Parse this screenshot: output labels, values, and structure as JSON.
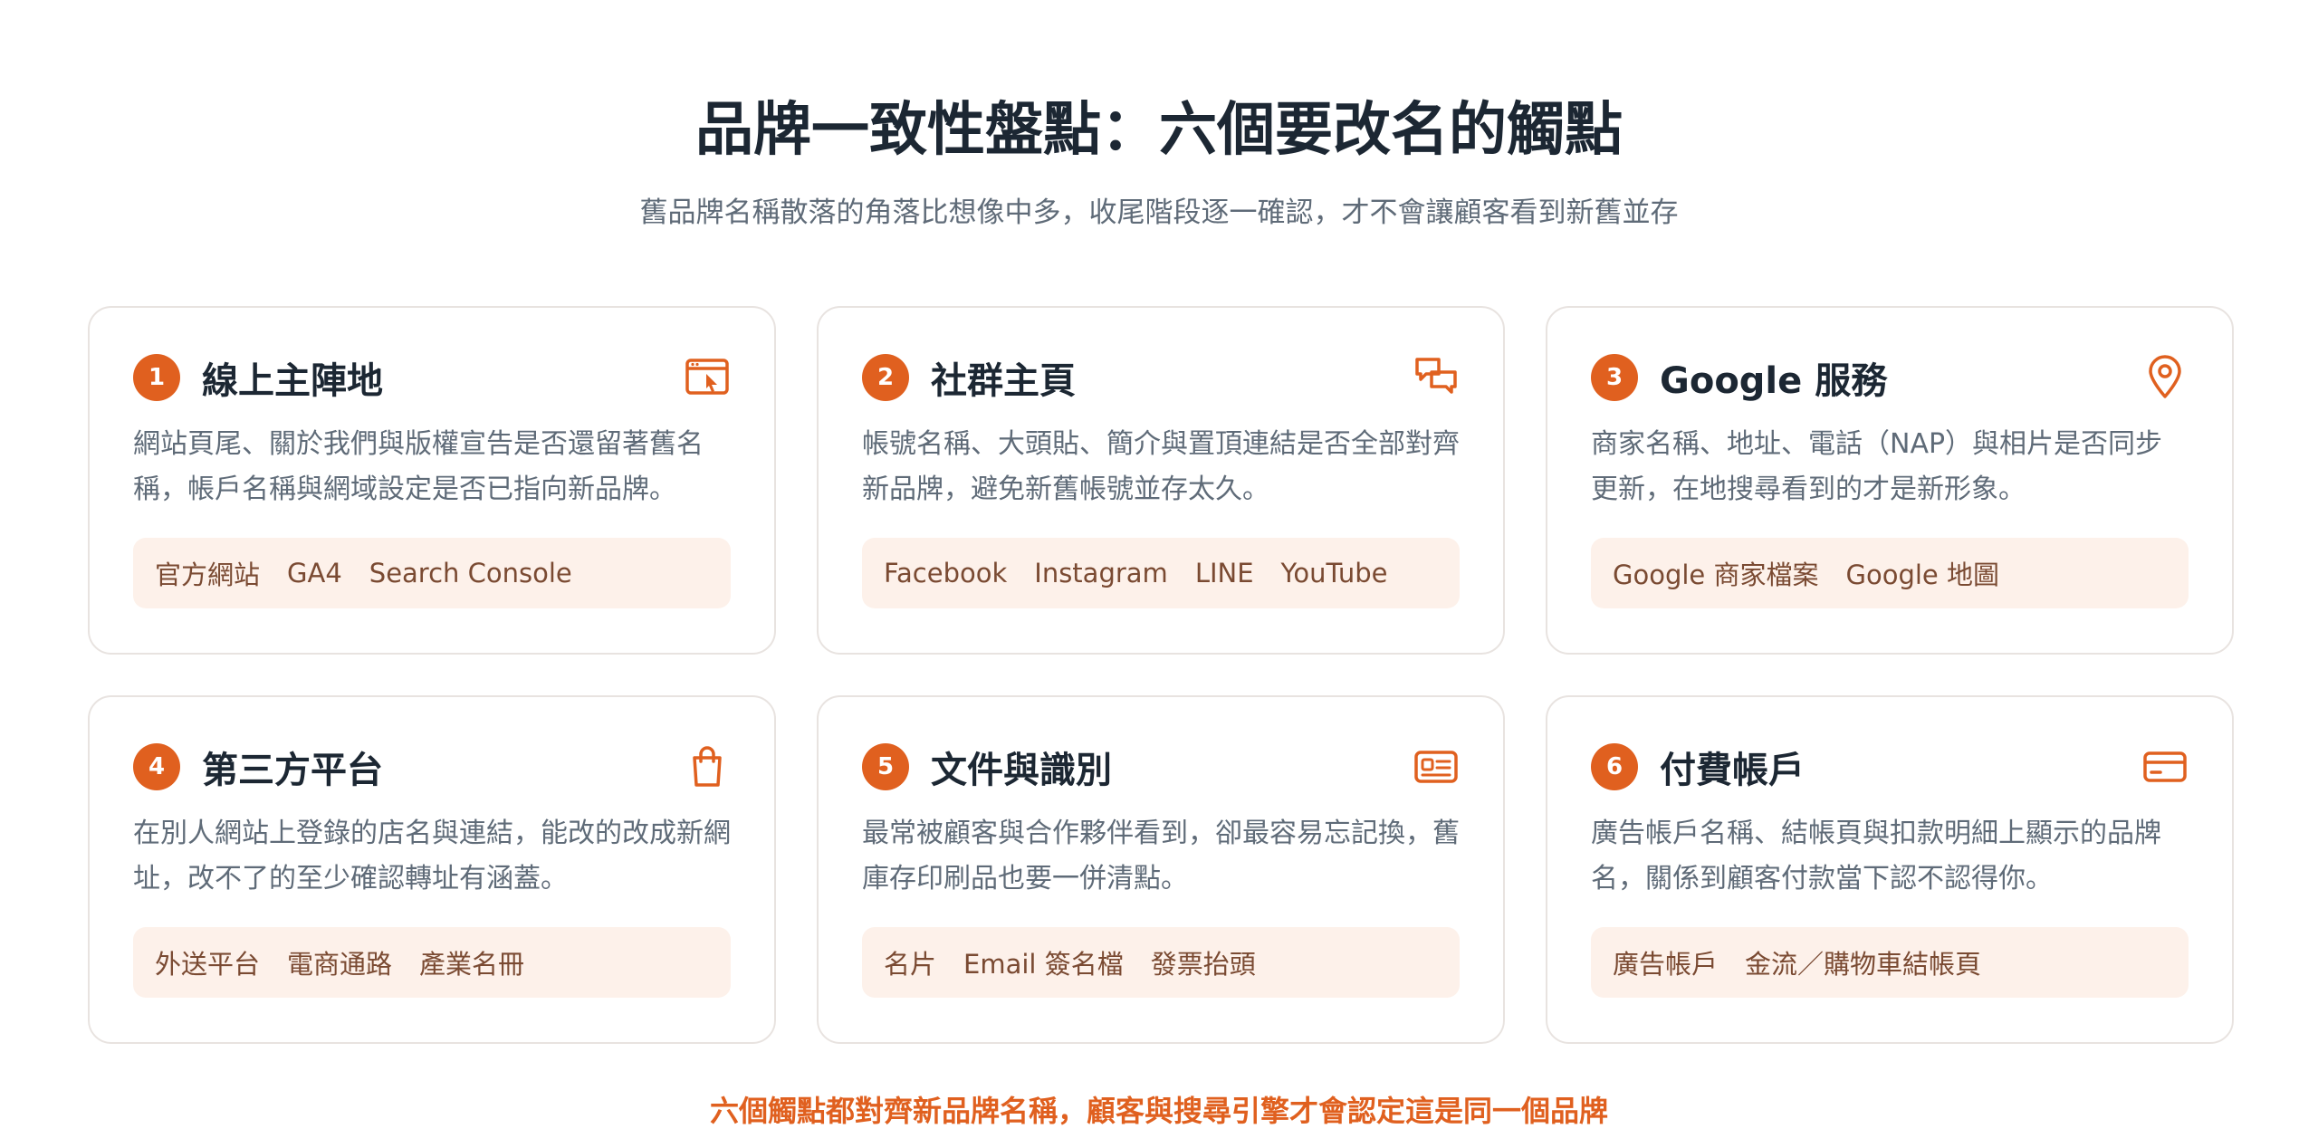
{
  "header": {
    "title": "品牌一致性盤點：六個要改名的觸點",
    "subtitle": "舊品牌名稱散落的角落比想像中多，收尾階段逐一確認，才不會讓顧客看到新舊並存"
  },
  "colors": {
    "accent": "#e0601f",
    "tag_bg": "#fdf1ea",
    "text_dark": "#1c2733",
    "text_muted": "#5f6b78"
  },
  "cards": [
    {
      "number": "1",
      "title": "線上主陣地",
      "icon": "browser-cursor-icon",
      "description": "網站頁尾、關於我們與版權宣告是否還留著舊名稱，帳戶名稱與網域設定是否已指向新品牌。",
      "tags": [
        "官方網站",
        "GA4",
        "Search Console"
      ]
    },
    {
      "number": "2",
      "title": "社群主頁",
      "icon": "chat-bubbles-icon",
      "description": "帳號名稱、大頭貼、簡介與置頂連結是否全部對齊新品牌，避免新舊帳號並存太久。",
      "tags": [
        "Facebook",
        "Instagram",
        "LINE",
        "YouTube"
      ]
    },
    {
      "number": "3",
      "title": "Google 服務",
      "icon": "map-pin-icon",
      "description": "商家名稱、地址、電話（NAP）與相片是否同步更新，在地搜尋看到的才是新形象。",
      "tags": [
        "Google 商家檔案",
        "Google 地圖"
      ]
    },
    {
      "number": "4",
      "title": "第三方平台",
      "icon": "shopping-bag-icon",
      "description": "在別人網站上登錄的店名與連結，能改的改成新網址，改不了的至少確認轉址有涵蓋。",
      "tags": [
        "外送平台",
        "電商通路",
        "產業名冊"
      ]
    },
    {
      "number": "5",
      "title": "文件與識別",
      "icon": "id-card-icon",
      "description": "最常被顧客與合作夥伴看到，卻最容易忘記換，舊庫存印刷品也要一併清點。",
      "tags": [
        "名片",
        "Email 簽名檔",
        "發票抬頭"
      ]
    },
    {
      "number": "6",
      "title": "付費帳戶",
      "icon": "credit-card-icon",
      "description": "廣告帳戶名稱、結帳頁與扣款明細上顯示的品牌名，關係到顧客付款當下認不認得你。",
      "tags": [
        "廣告帳戶",
        "金流／購物車結帳頁"
      ]
    }
  ],
  "footer": {
    "note": "六個觸點都對齊新品牌名稱，顧客與搜尋引擎才會認定這是同一個品牌"
  }
}
